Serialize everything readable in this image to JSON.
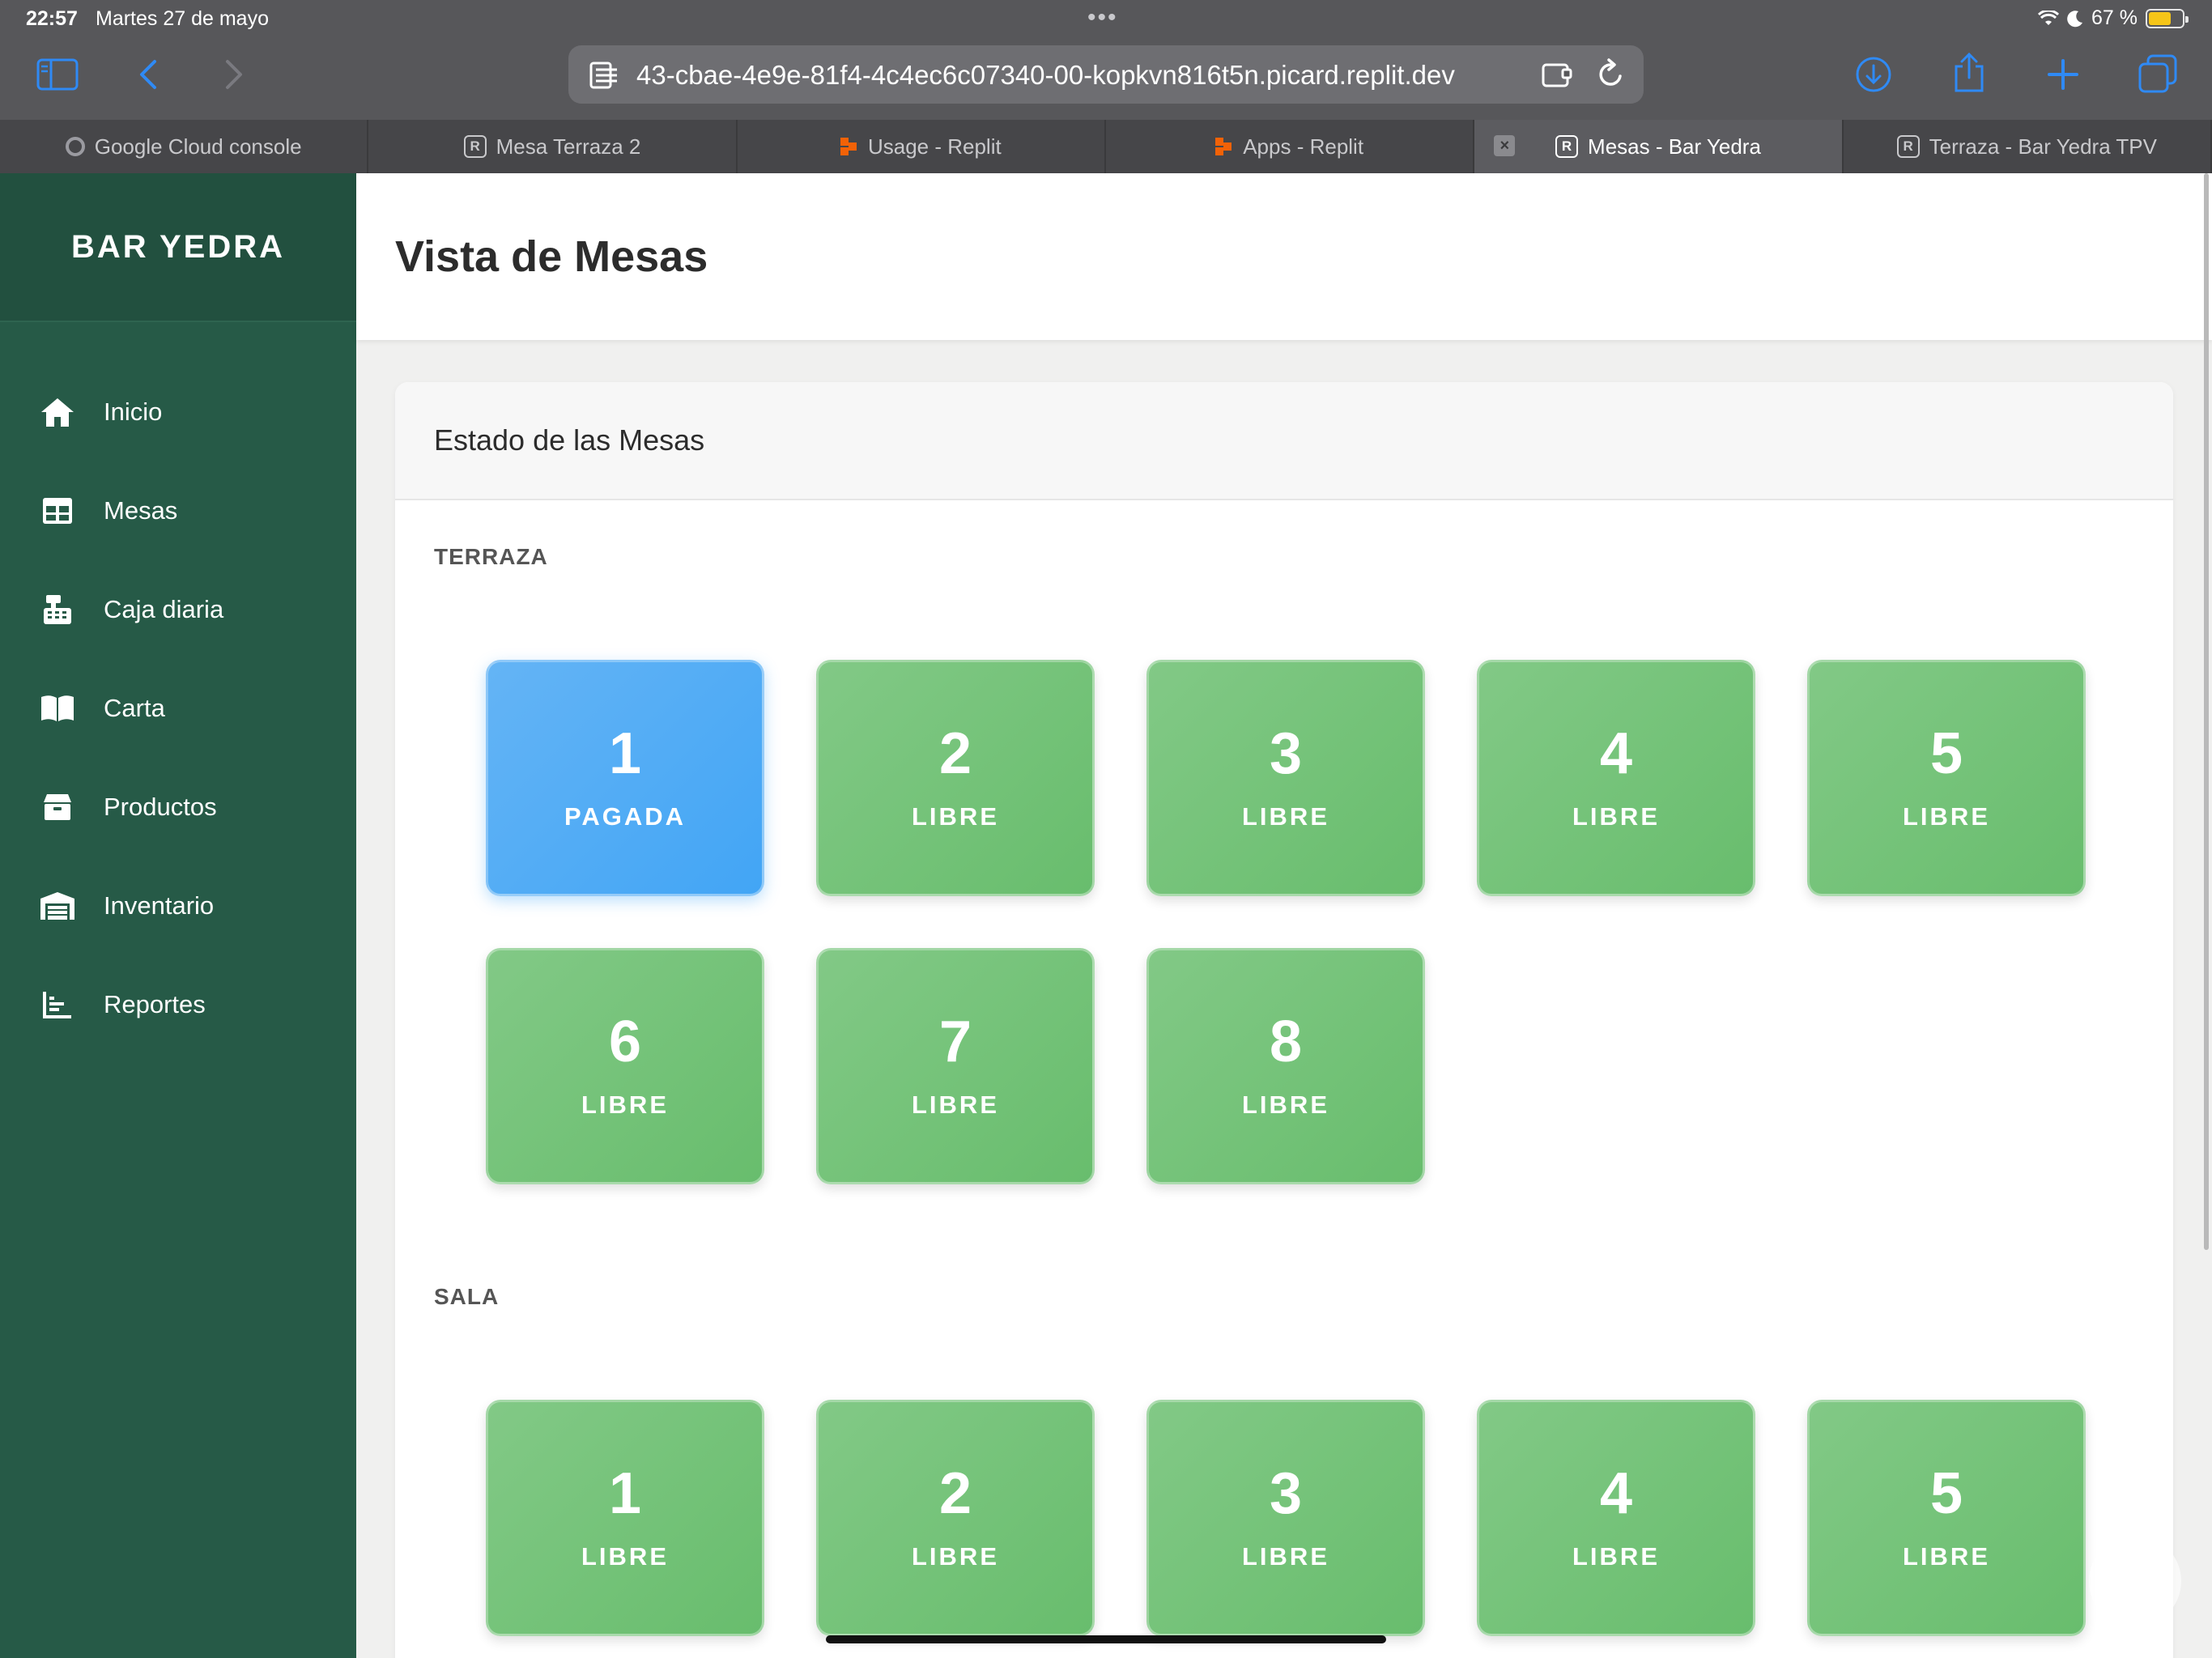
{
  "status_bar": {
    "time": "22:57",
    "date": "Martes 27 de mayo",
    "battery": "67 %",
    "battery_level": 0.67
  },
  "browser": {
    "url": "43-cbae-4e9e-81f4-4c4ec6c07340-00-kopkvn816t5n.picard.replit.dev",
    "tabs": [
      {
        "label": "Google Cloud console",
        "icon": "gear-icon",
        "active": false
      },
      {
        "label": "Mesa Terraza 2",
        "icon": "replit-r-icon",
        "active": false
      },
      {
        "label": "Usage - Replit",
        "icon": "replit-logo-icon",
        "active": false
      },
      {
        "label": "Apps - Replit",
        "icon": "replit-logo-icon",
        "active": false
      },
      {
        "label": "Mesas - Bar Yedra",
        "icon": "replit-r-icon",
        "active": true
      },
      {
        "label": "Terraza - Bar Yedra TPV",
        "icon": "replit-r-icon",
        "active": false
      }
    ]
  },
  "sidebar": {
    "brand": "BAR YEDRA",
    "items": [
      {
        "label": "Inicio",
        "icon": "home-icon"
      },
      {
        "label": "Mesas",
        "icon": "table-icon"
      },
      {
        "label": "Caja diaria",
        "icon": "cash-register-icon"
      },
      {
        "label": "Carta",
        "icon": "book-open-icon"
      },
      {
        "label": "Productos",
        "icon": "box-icon"
      },
      {
        "label": "Inventario",
        "icon": "warehouse-icon"
      },
      {
        "label": "Reportes",
        "icon": "chart-icon"
      }
    ]
  },
  "main": {
    "title": "Vista de Mesas",
    "card_title": "Estado de las Mesas",
    "zones": [
      {
        "name": "TERRAZA",
        "tables": [
          {
            "number": "1",
            "state": "PAGADA"
          },
          {
            "number": "2",
            "state": "LIBRE"
          },
          {
            "number": "3",
            "state": "LIBRE"
          },
          {
            "number": "4",
            "state": "LIBRE"
          },
          {
            "number": "5",
            "state": "LIBRE"
          },
          {
            "number": "6",
            "state": "LIBRE"
          },
          {
            "number": "7",
            "state": "LIBRE"
          },
          {
            "number": "8",
            "state": "LIBRE"
          }
        ]
      },
      {
        "name": "SALA",
        "tables": [
          {
            "number": "1",
            "state": "LIBRE"
          },
          {
            "number": "2",
            "state": "LIBRE"
          },
          {
            "number": "3",
            "state": "LIBRE"
          },
          {
            "number": "4",
            "state": "LIBRE"
          },
          {
            "number": "5",
            "state": "LIBRE"
          }
        ]
      }
    ]
  },
  "colors": {
    "sidebar": "#265a47",
    "libre": "#6cbf71",
    "pagada": "#42a5f5",
    "accent": "#2f8af5"
  }
}
